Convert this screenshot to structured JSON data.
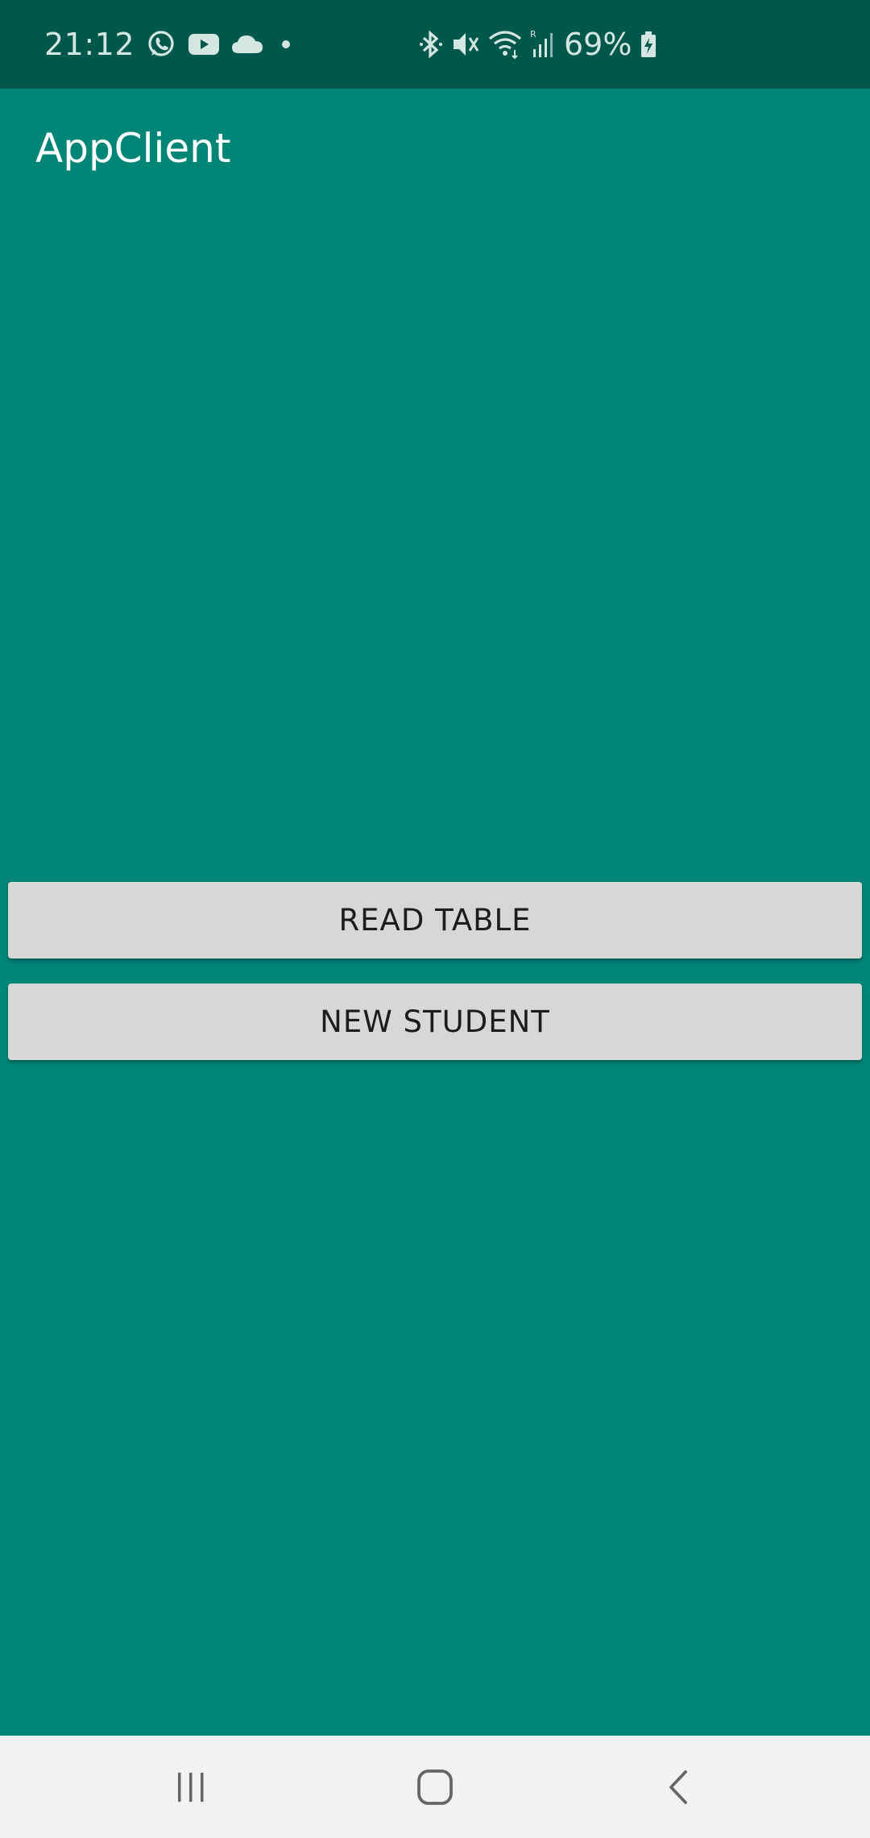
{
  "status_bar": {
    "time": "21:12",
    "battery_percent": "69%",
    "left_icons": [
      "whatsapp-icon",
      "youtube-icon",
      "cloud-icon",
      "dot-icon"
    ],
    "right_icons": [
      "bluetooth-icon",
      "mute-icon",
      "wifi-icon",
      "signal-icon",
      "battery-icon"
    ]
  },
  "app_bar": {
    "title": "AppClient"
  },
  "main": {
    "read_table_label": "READ TABLE",
    "new_student_label": "NEW STUDENT"
  },
  "nav_bar": {
    "icons": [
      "recent-apps-icon",
      "home-icon",
      "back-icon"
    ]
  },
  "colors": {
    "status_bar": "#00574b",
    "primary": "#008577",
    "button_bg": "#d6d7d7",
    "nav_bar": "#f2f2f2"
  }
}
